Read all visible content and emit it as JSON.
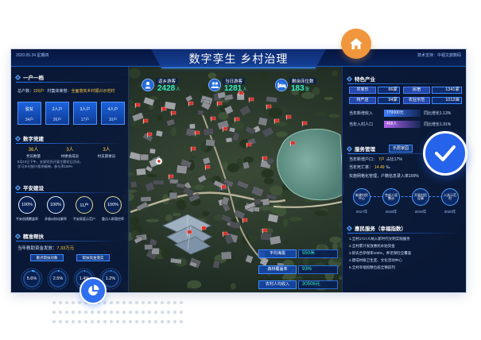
{
  "header": {
    "date": "2020.05.24 星期四",
    "title": "数字孪生 乡村治理",
    "support": "技术支持：中视文旅数码"
  },
  "household": {
    "title": "一户一档",
    "total_label": "总户数：",
    "total_value": "220户",
    "honor_label": "村集体荣誉：",
    "honor_value": "全面落实乡村振兴示范村",
    "tiles": [
      {
        "label": "脱贫",
        "value": "34户"
      },
      {
        "label": "2人户",
        "value": "26户"
      },
      {
        "label": "3人户",
        "value": "17户"
      },
      {
        "label": "4人户",
        "value": "10户"
      }
    ]
  },
  "party": {
    "title": "数字党建",
    "stats": [
      {
        "value": "36人",
        "label": "党员数量"
      },
      {
        "value": "3人",
        "label": "村委会成员"
      },
      {
        "value": "3人",
        "label": "村支部委员"
      }
    ],
    "notice": [
      "6月10日下午，支部党员开展主题党日活动，",
      "学习乡村振兴相关精神，参与率100%"
    ]
  },
  "safety": {
    "title": "平安建设",
    "rings": [
      {
        "value": "100%",
        "label": "平安创建覆盖率",
        "color": "#e8f1ff"
      },
      {
        "value": "100%",
        "label": "矛盾纠纷化解率",
        "color": "#e8f1ff"
      },
      {
        "value": "11户",
        "label": "平安家庭示范户",
        "color": "#e8d88a"
      },
      {
        "value": "100%",
        "label": "重点人群管控率",
        "color": "#e8d88a"
      }
    ]
  },
  "aid": {
    "title": "精准帮扶",
    "fund_label": "当年救助资金发放：",
    "fund_value": "7.33万元",
    "buttons": [
      "重点帮扶对象",
      "帮扶资金落实"
    ],
    "gauges": [
      "5.6%",
      "2.5%",
      "1.4%",
      "1.2%"
    ]
  },
  "center": {
    "stats": [
      {
        "label": "返乡游客",
        "value": "2428",
        "unit": "人",
        "icon": "person-icon"
      },
      {
        "label": "当日游客",
        "value": "1281",
        "unit": "人",
        "icon": "group-icon"
      },
      {
        "label": "剩余床位数",
        "value": "183",
        "unit": "张",
        "icon": "bed-icon"
      }
    ],
    "facts": [
      {
        "label": "平均海拔",
        "value": "550米"
      },
      {
        "label": "森林覆盖率",
        "value": "93%"
      },
      {
        "label": "农村人均收入",
        "value": "30506元"
      }
    ]
  },
  "industry": {
    "title": "特色产业",
    "items": [
      {
        "label": "农家乐",
        "value": "66家"
      },
      {
        "label": "民宿",
        "value": "1341家"
      },
      {
        "label": "特产店",
        "value": "94家"
      },
      {
        "label": "农业示范",
        "value": "1012亩"
      }
    ],
    "growth": [
      {
        "label": "当年新增收入",
        "value": "770000元",
        "trend": "同比增长1.13%",
        "color": "#3b7cff"
      },
      {
        "label": "当年入村人口",
        "value": "468人",
        "trend": "同比增长1.91%",
        "color": "#b565f0"
      }
    ]
  },
  "service": {
    "title": "服务管理",
    "tab": "乐居家园",
    "lines": [
      {
        "label": "当年新增户口：",
        "value": "7户",
        "extra": "占比17%"
      },
      {
        "label": "当年死亡率：",
        "value": "14.49",
        "extra": "‰"
      },
      {
        "label": "实施网格化管理，户籍信息录入率100%",
        "value": "",
        "extra": ""
      }
    ],
    "timeline": [
      {
        "label": "新建村民中心",
        "year": "2017年"
      },
      {
        "label": "完成人居整治",
        "year": "2018年"
      },
      {
        "label": "开展村民议事",
        "year": "2019年"
      },
      {
        "label": "入选示范村",
        "year": "2020年"
      }
    ]
  },
  "welfare": {
    "title": "惠民服务（幸福指数）",
    "lines": [
      "1.全村1717人纳入新时代文明实践服务",
      "2.全村累计发放惠民补贴资金",
      "3.新农合参保率100%，养老保险全覆盖",
      "4.建成村级卫生室、文化活动中心",
      "5.全村幸福指数位居全镇前列"
    ]
  },
  "badges": {
    "home": "home-icon",
    "check": "check-icon",
    "pie": "pie-chart-icon"
  },
  "colors": {
    "panel": "#0b1733",
    "accent": "#2f6ff0",
    "orange": "#f0963c",
    "value_green": "#33f0c4",
    "value_yellow": "#ffcf3f",
    "marker_red": "#d9302c"
  }
}
